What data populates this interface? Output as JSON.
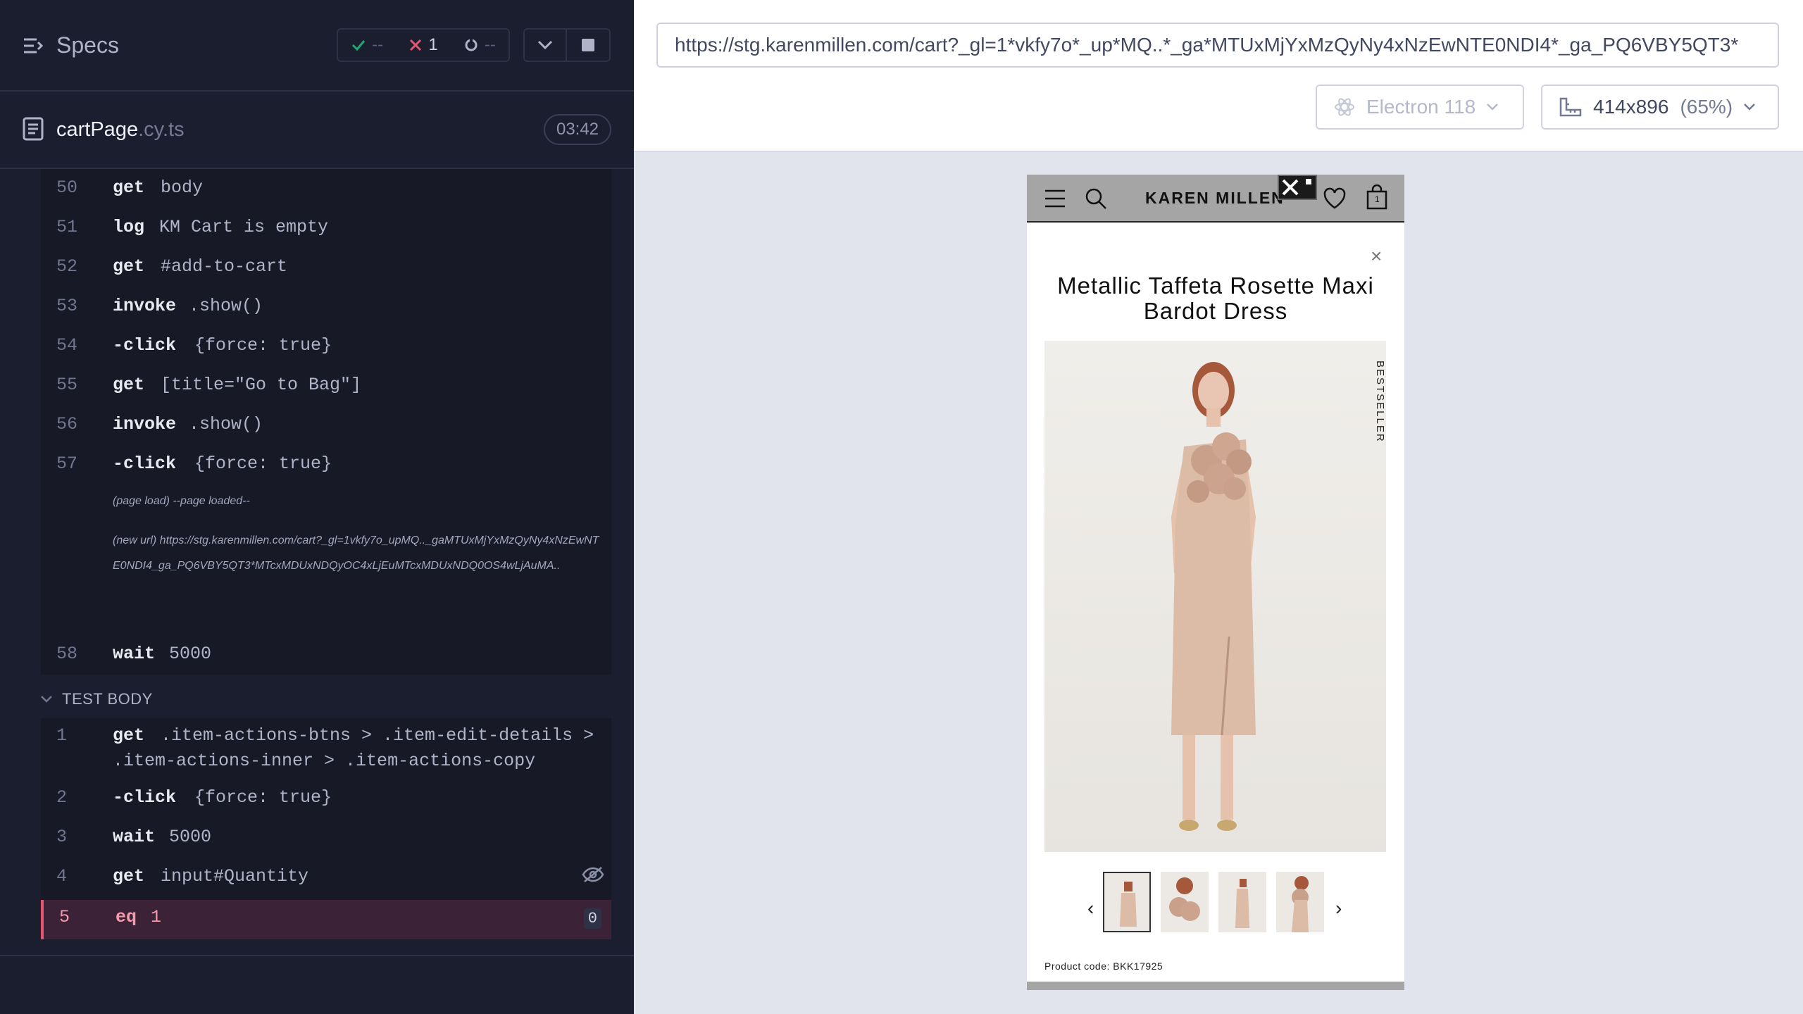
{
  "reporter": {
    "specs_label": "Specs",
    "stats": {
      "passed": "--",
      "failed": "1",
      "pending": "--"
    },
    "spec_file": {
      "name": "cartPage",
      "ext": ".cy.ts",
      "duration": "03:42"
    },
    "commands": [
      {
        "num": "50",
        "name": "get",
        "msg": "body"
      },
      {
        "num": "51",
        "name": "log",
        "msg": "KM Cart is empty"
      },
      {
        "num": "52",
        "name": "get",
        "msg": "#add-to-cart"
      },
      {
        "num": "53",
        "name": "invoke",
        "msg": ".show()"
      },
      {
        "num": "54",
        "name": "-click",
        "msg": "{force: true}"
      },
      {
        "num": "55",
        "name": "get",
        "msg": "[title=\"Go to Bag\"]"
      },
      {
        "num": "56",
        "name": "invoke",
        "msg": ".show()"
      },
      {
        "num": "57",
        "name": "-click",
        "msg": "{force: true}"
      }
    ],
    "page_load_event": "(page load)  --page loaded--",
    "new_url_event": "(new url)  https://stg.karenmillen.com/cart?_gl=1vkfy7o_upMQ.._gaMTUxMjYxMzQyNy4xNzEwNTE0NDI4_ga_PQ6VBY5QT3*MTcxMDUxNDQyOC4xLjEuMTcxMDUxNDQ0OS4wLjAuMA..",
    "wait_command": {
      "num": "58",
      "name": "wait",
      "msg": "5000"
    },
    "test_body_label": "TEST BODY",
    "body_commands": [
      {
        "num": "1",
        "name": "get",
        "msg": ".item-actions-btns > .item-edit-details >",
        "msg2": ".item-actions-inner > .item-actions-copy"
      },
      {
        "num": "2",
        "name": "-click",
        "msg": "{force: true}"
      },
      {
        "num": "3",
        "name": "wait",
        "msg": "5000"
      },
      {
        "num": "4",
        "name": "get",
        "msg": "input#Quantity"
      },
      {
        "num": "5",
        "name": "eq",
        "msg": "1",
        "badge": "0"
      }
    ]
  },
  "aut": {
    "url": "https://stg.karenmillen.com/cart?_gl=1*vkfy7o*_up*MQ..*_ga*MTUxMjYxMzQyNy4xNzEwNTE0NDI4*_ga_PQ6VBY5QT3*",
    "browser": "Electron 118",
    "viewport": "414x896",
    "viewport_pct": "(65%)"
  },
  "site": {
    "brand": "KAREN MILLEN",
    "bag_count": "1",
    "product_title": "Metallic Taffeta Rosette Maxi Bardot Dress",
    "badge": "BESTSELLER",
    "product_code": "Product code: BKK17925",
    "thumbnail_count": 4
  },
  "colors": {
    "reporter_bg": "#1b1e2e",
    "command_bg": "#171926",
    "fail_bg": "#3b2236",
    "fail_accent": "#e45770",
    "pass_green": "#1fa971",
    "fail_red": "#e45770"
  }
}
